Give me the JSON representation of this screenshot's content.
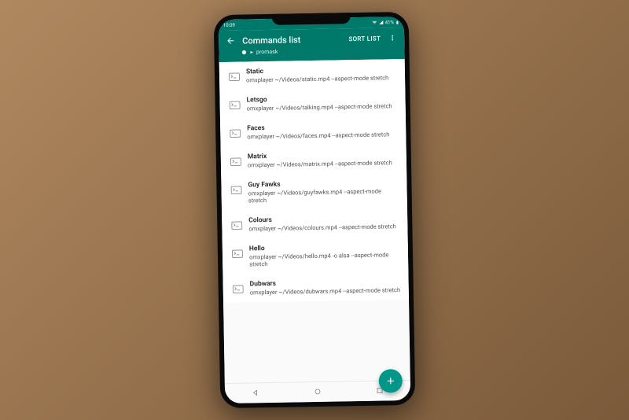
{
  "status": {
    "time": "10:09",
    "battery": "41%"
  },
  "appbar": {
    "title": "Commands list",
    "sort_label": "SORT LIST"
  },
  "breadcrumb": {
    "host": "promask"
  },
  "items": [
    {
      "title": "Static",
      "sub": "omxplayer ~/Videos/static.mp4 --aspect-mode stretch"
    },
    {
      "title": "Letsgo",
      "sub": "omxplayer ~/Videos/talking.mp4 --aspect-mode stretch"
    },
    {
      "title": "Faces",
      "sub": "omxplayer ~/Videos/faces.mp4 --aspect-mode stretch"
    },
    {
      "title": "Matrix",
      "sub": "omxplayer ~/Videos/matrix.mp4 --aspect-mode stretch"
    },
    {
      "title": "Guy Fawks",
      "sub": "omxplayer ~/Videos/guyfawks.mp4 --aspect-mode stretch"
    },
    {
      "title": "Colours",
      "sub": "omxplayer ~/Videos/colours.mp4 --aspect-mode stretch"
    },
    {
      "title": "Hello",
      "sub": "omxplayer ~/Videos/hello.mp4 -o alsa --aspect-mode stretch"
    },
    {
      "title": "Dubwars",
      "sub": "omxplayer ~/Videos/dubwars.mp4 --aspect-mode stretch"
    }
  ]
}
